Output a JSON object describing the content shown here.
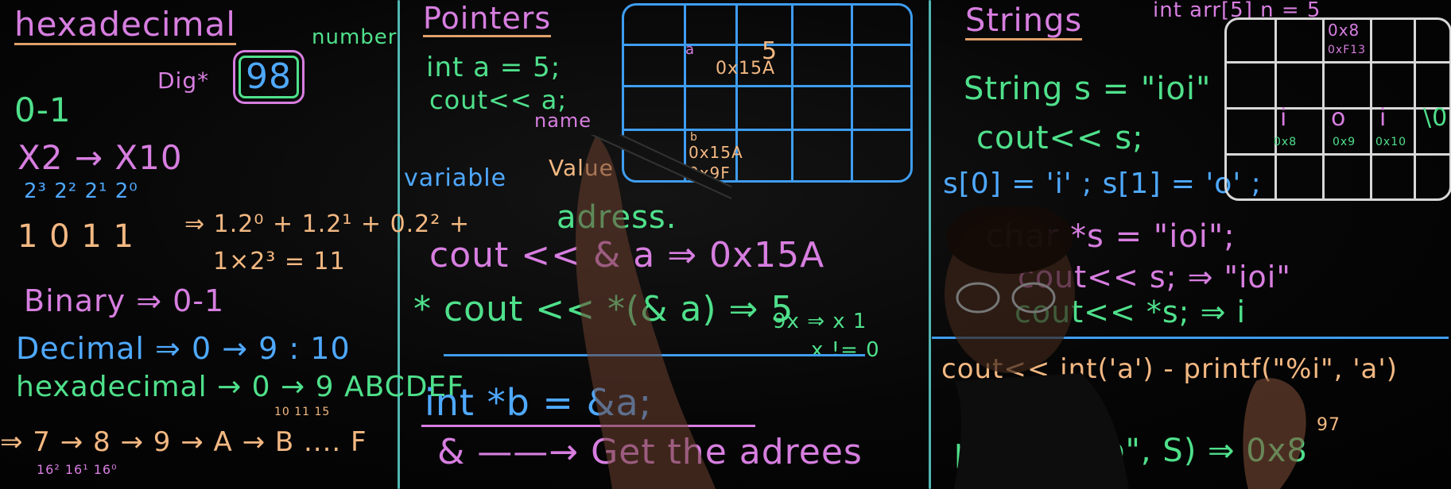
{
  "left_panel": {
    "title": "hexadecimal",
    "digit_label": "Dig*",
    "digits": "98",
    "number_label": "number",
    "range_01": "0-1",
    "base_conv": "X2 → X10",
    "powers": "2³ 2² 2¹ 2⁰",
    "bits": "1 0 1 1",
    "expansion": "⇒ 1.2⁰ + 1.2¹ + 0.2² +",
    "expansion2": "1×2³ = 11",
    "binary": "Binary ⇒ 0-1",
    "decimal": "Decimal ⇒ 0 → 9 : 10",
    "hexadecimal": "hexadecimal → 0 → 9 ABCDEF",
    "hex_small": "10 11          15",
    "sequence": "⇒ 7 → 8 → 9 → A → B .... F",
    "sequence_small": "16² 16¹ 16⁰"
  },
  "middle_panel": {
    "title": "Pointers",
    "code1": "int a = 5;",
    "code2": "cout<< a;",
    "variable": "variable",
    "name": "name",
    "value": "Value",
    "address": "adress.",
    "cell_a": "a",
    "cell_5": "5",
    "cell_addr1": "0x15A",
    "cell_b": "b",
    "cell_addr2": "0x15A",
    "cell_addr3": "0x9F",
    "cout_addr": "cout << & a ⇒ 0x15A",
    "cout_deref": "* cout << *(& a) ⇒ 5",
    "side_note": "9x ⇒ x 1",
    "side_note2": "x != 0",
    "int_ptr": "int *b = &a;",
    "get_addr": "& ——→ Get the adrees"
  },
  "right_panel": {
    "title": "Strings",
    "header_code": "int arr[5] n = 5",
    "string_decl": "String s = \"ioi\"",
    "cout_s": "cout<< s;",
    "index": "s[0] = 'i' ; s[1] = 'o' ;",
    "char_ptr": "char *s = \"ioi\";",
    "cout_s2": "cout<< s; ⇒ \"ioi\"",
    "cout_deref": "cout<< *s; ⇒ i",
    "cout_int": "cout<< int('a') - printf(\"%i\", 'a')",
    "num_97": "97",
    "num_97b": "97",
    "printf_p": "printf(\"%p\", S) ⇒ 0x8",
    "grid_addr1": "0x8",
    "grid_addr2": "0xF13",
    "grid_cells": [
      "i",
      "o",
      "i",
      "\\0"
    ],
    "grid_addrs": [
      "0x8",
      "0x9",
      "0x10"
    ]
  },
  "colors": {
    "pink": "#d77ee0",
    "green": "#4fe08b",
    "blue": "#4fa9ff",
    "orange": "#f3b882",
    "cyan": "#5fd6d0",
    "board": "#050505"
  }
}
